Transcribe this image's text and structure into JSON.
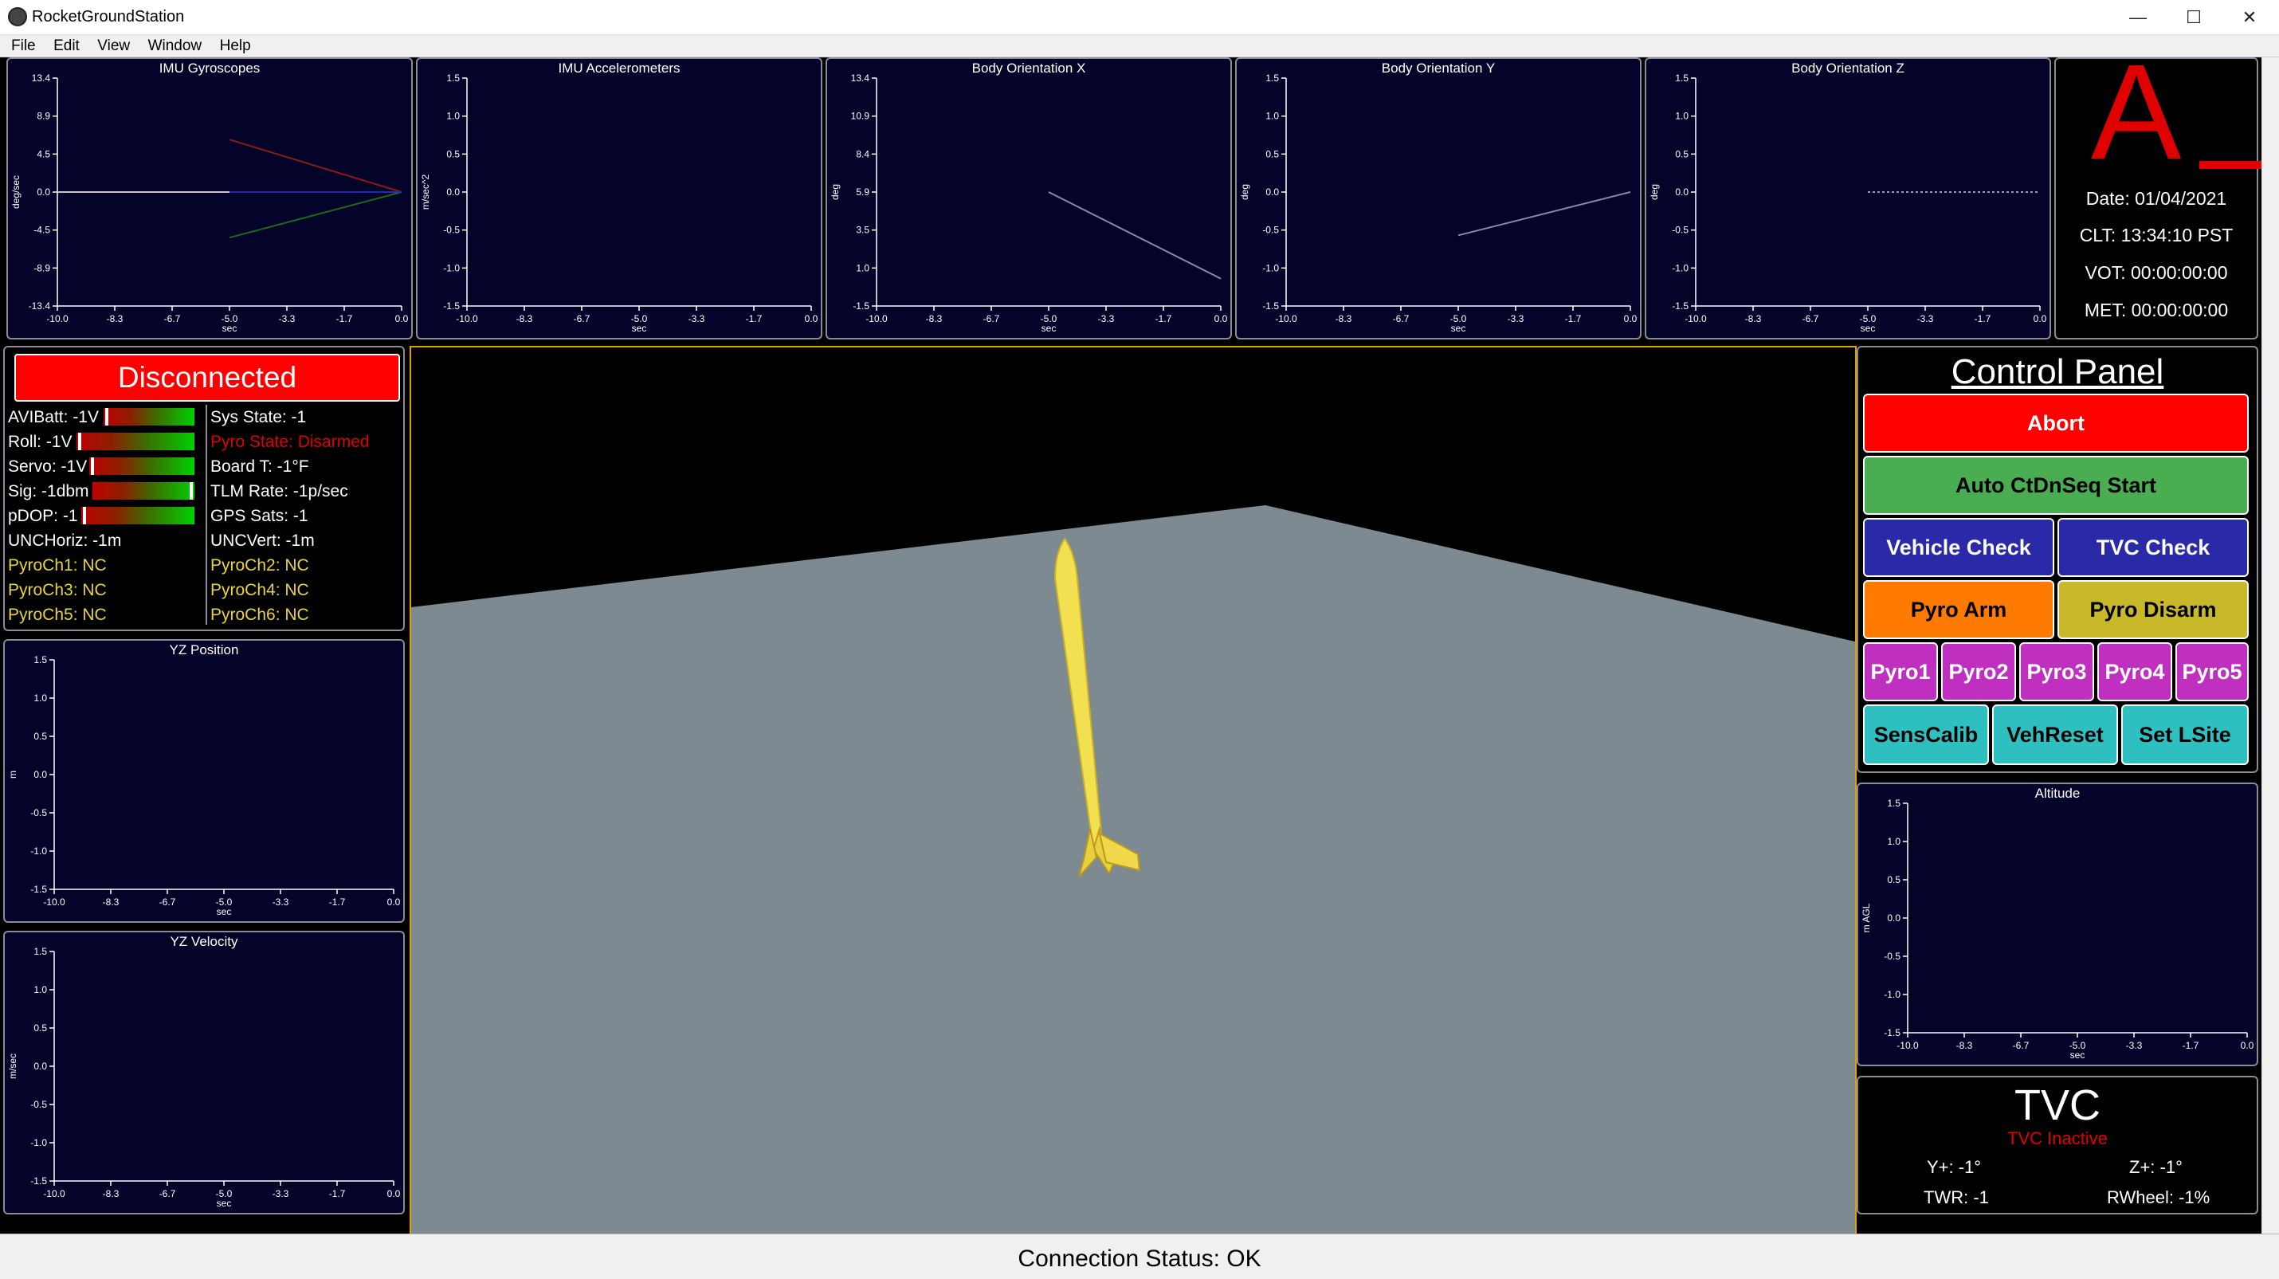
{
  "window": {
    "title": "RocketGroundStation",
    "minimize": "—",
    "maximize": "☐",
    "close": "✕"
  },
  "menu": [
    "File",
    "Edit",
    "View",
    "Window",
    "Help"
  ],
  "plots": {
    "x_ticks": [
      "-10.0",
      "-8.3",
      "-6.7",
      "-5.0",
      "-3.3",
      "-1.7",
      "0.0"
    ],
    "x_label": "sec",
    "imu_gyro": {
      "title": "IMU Gyroscopes",
      "ylabel": "deg/sec",
      "yticks": [
        "13.4",
        "8.9",
        "4.5",
        "0.0",
        "-4.5",
        "-8.9",
        "-13.4"
      ]
    },
    "imu_accel": {
      "title": "IMU Accelerometers",
      "ylabel": "m/sec^2",
      "yticks": [
        "1.5",
        "1.0",
        "0.5",
        "0.0",
        "-0.5",
        "-1.0",
        "-1.5"
      ]
    },
    "body_x": {
      "title": "Body Orientation X",
      "ylabel": "deg",
      "yticks": [
        "13.4",
        "10.9",
        "8.4",
        "5.9",
        "3.5",
        "1.0",
        "-1.5"
      ]
    },
    "body_y": {
      "title": "Body Orientation Y",
      "ylabel": "deg",
      "yticks": [
        "1.5",
        "1.0",
        "0.5",
        "0.0",
        "-0.5",
        "-1.0",
        "-1.5"
      ]
    },
    "body_z": {
      "title": "Body Orientation Z",
      "ylabel": "deg",
      "yticks": [
        "1.5",
        "1.0",
        "0.5",
        "0.0",
        "-0.5",
        "-1.0",
        "-1.5"
      ]
    },
    "yz_position": {
      "title": "YZ Position",
      "ylabel": "m",
      "yticks": [
        "1.5",
        "1.0",
        "0.5",
        "0.0",
        "-0.5",
        "-1.0",
        "-1.5"
      ]
    },
    "yz_velocity": {
      "title": "YZ Velocity",
      "ylabel": "m/sec",
      "yticks": [
        "1.5",
        "1.0",
        "0.5",
        "0.0",
        "-0.5",
        "-1.0",
        "-1.5"
      ]
    },
    "altitude": {
      "title": "Altitude",
      "ylabel": "m AGL",
      "yticks": [
        "1.5",
        "1.0",
        "0.5",
        "0.0",
        "-0.5",
        "-1.0",
        "-1.5"
      ]
    }
  },
  "info": {
    "big_letter": "A",
    "date": "Date: 01/04/2021",
    "clt": "CLT: 13:34:10 PST",
    "vot": "VOT: 00:00:00:00",
    "met": "MET: 00:00:00:00"
  },
  "status": {
    "connection": "Disconnected",
    "avibatt": "AVIBatt: -1V",
    "roll": "Roll: -1V",
    "servo": "Servo: -1V",
    "sig": "Sig: -1dbm",
    "pdop": "pDOP: -1",
    "unc_horiz": "UNCHoriz: -1m",
    "pyro_ch1": "PyroCh1: NC",
    "pyro_ch3": "PyroCh3: NC",
    "pyro_ch5": "PyroCh5: NC",
    "sys_state": "Sys State: -1",
    "pyro_state": "Pyro State: Disarmed",
    "board_t": "Board T: -1°F",
    "tlm_rate": "TLM Rate: -1p/sec",
    "gps_sats": "GPS Sats: -1",
    "unc_vert": "UNCVert: -1m",
    "pyro_ch2": "PyroCh2: NC",
    "pyro_ch4": "PyroCh4: NC",
    "pyro_ch6": "PyroCh6: NC"
  },
  "control_panel": {
    "title": "Control Panel",
    "abort": "Abort",
    "auto_seq": "Auto CtDnSeq Start",
    "vehicle_check": "Vehicle Check",
    "tvc_check": "TVC Check",
    "pyro_arm": "Pyro Arm",
    "pyro_disarm": "Pyro Disarm",
    "pyro1": "Pyro1",
    "pyro2": "Pyro2",
    "pyro3": "Pyro3",
    "pyro4": "Pyro4",
    "pyro5": "Pyro5",
    "sens_calib": "SensCalib",
    "veh_reset": "VehReset",
    "set_lsite": "Set LSite"
  },
  "tvc": {
    "title": "TVC",
    "state": "TVC Inactive",
    "y_plus": "Y+: -1°",
    "z_plus": "Z+: -1°",
    "twr": "TWR: -1",
    "rwheel": "RWheel: -1%"
  },
  "status_bar": "Connection Status: OK",
  "colors": {
    "plot_bg": "#04032a",
    "abort": "#ff0000",
    "green_btn": "#4aad52",
    "blue_btn": "#2a2aa8",
    "orange_btn": "#ff7a00",
    "olive_btn": "#c8b82a",
    "magenta_btn": "#c030c0",
    "cyan_btn": "#2ec0c0",
    "rocket": "#f2e050",
    "ground": "#7d8a91"
  }
}
